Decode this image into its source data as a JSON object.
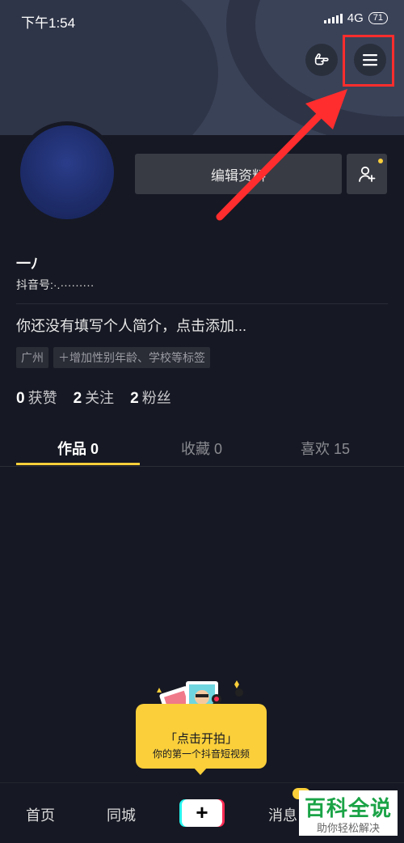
{
  "status_bar": {
    "time": "下午1:54",
    "network": "4G",
    "battery": "71"
  },
  "profile": {
    "edit_button": "编辑资料",
    "username": "一ﾉ",
    "douyin_id": "抖音号:·.·········",
    "bio": "你还没有填写个人简介，点击添加...",
    "tags": [
      "广州",
      "＋增加性别年龄、学校等标签"
    ]
  },
  "stats": [
    {
      "count": "0",
      "label": "获赞"
    },
    {
      "count": "2",
      "label": "关注"
    },
    {
      "count": "2",
      "label": "粉丝"
    }
  ],
  "tabs": [
    {
      "label": "作品 0",
      "active": true
    },
    {
      "label": "收藏 0",
      "active": false
    },
    {
      "label": "喜欢 15",
      "active": false
    }
  ],
  "bubble": {
    "title": "「点击开拍」",
    "subtitle": "你的第一个抖音短视频"
  },
  "bottom_nav": {
    "home": "首页",
    "nearby": "同城",
    "create": "+",
    "messages": "消息"
  },
  "watermark": {
    "title": "百科全说",
    "subtitle": "助你轻松解决"
  },
  "colors": {
    "accent": "#facf3a",
    "annotation": "#ff2d2d",
    "background": "#161823"
  }
}
